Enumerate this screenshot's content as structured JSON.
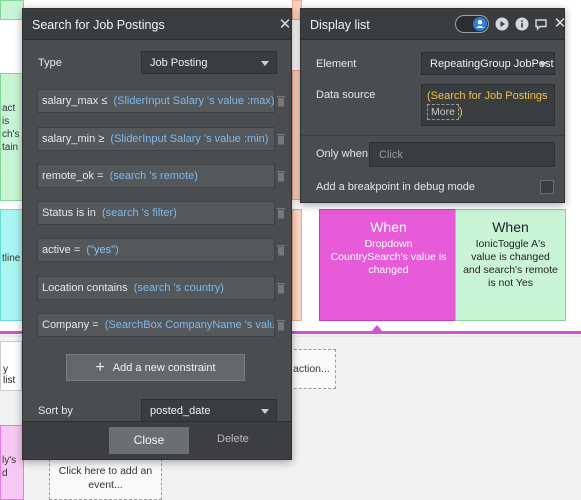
{
  "background": {
    "left_tile_1_text": "act is\nch's\ntain",
    "left_tile_2_text": "tline",
    "left_stub_text": "y list",
    "left_pink_tile_text": "ly's\nd",
    "action_stub_text": "action...",
    "add_event_text": "Click here to add an event...",
    "when_pink": {
      "title": "When",
      "body": "Dropdown CountrySearch's value is changed"
    },
    "when_green": {
      "title": "When",
      "body": "IonicToggle A's value is changed and search's remote is not Yes"
    }
  },
  "search_panel": {
    "title": "Search for Job Postings",
    "type_label": "Type",
    "type_value": "Job Posting",
    "constraints": [
      {
        "field": "salary_max",
        "op": "≤",
        "value": "SliderInput Salary 's value :max"
      },
      {
        "field": "salary_min",
        "op": "≥",
        "value": "SliderInput Salary 's value :min"
      },
      {
        "field": "remote_ok",
        "op": "=",
        "value": "search 's remote"
      },
      {
        "field": "Status",
        "op": "is in",
        "value": "search 's filter"
      },
      {
        "field": "active",
        "op": "=",
        "value": "\"yes\""
      },
      {
        "field": "Location",
        "op": "contains",
        "value": "search 's country"
      },
      {
        "field": "Company",
        "op": "=",
        "value": "SearchBox CompanyName 's value"
      }
    ],
    "add_constraint_label": "Add a new constraint",
    "sort_label": "Sort by",
    "sort_value": "posted_date",
    "close_label": "Close",
    "delete_label": "Delete"
  },
  "display_panel": {
    "title": "Display list",
    "element_label": "Element",
    "element_value": "RepeatingGroup JobPostings",
    "data_source_label": "Data source",
    "data_source_open": "(",
    "data_source_value": "Search for Job Postings",
    "data_source_more": "More",
    "data_source_close": ")",
    "only_when_label": "Only when",
    "only_when_placeholder": "Click",
    "breakpoint_label": "Add a breakpoint in debug mode",
    "breakpoint_checked": false
  },
  "colors": {
    "panel_bg": "#4a4d50",
    "dynamic_text": "#7fb8ea",
    "yellow_expr": "#f0c04a",
    "workflow_pink": "#e75ad8",
    "workflow_green": "#c9f5d6",
    "toggle_blue": "#2f7fd8"
  }
}
